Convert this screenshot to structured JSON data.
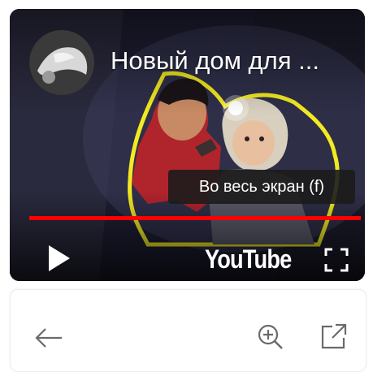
{
  "video": {
    "title": "Новый дом для ...",
    "tooltip": "Во весь экран (f)",
    "logo_text": "YouTube",
    "progress": 1.0
  },
  "colors": {
    "progress": "#ff0000",
    "tooltip_bg": "#1c1c1c",
    "glow_outline": "#f2ea22"
  },
  "icons": {
    "avatar": "channel-avatar",
    "play": "play-icon",
    "fullscreen": "fullscreen-icon",
    "back": "arrow-left-icon",
    "zoom": "zoom-in-icon",
    "open": "open-external-icon"
  }
}
